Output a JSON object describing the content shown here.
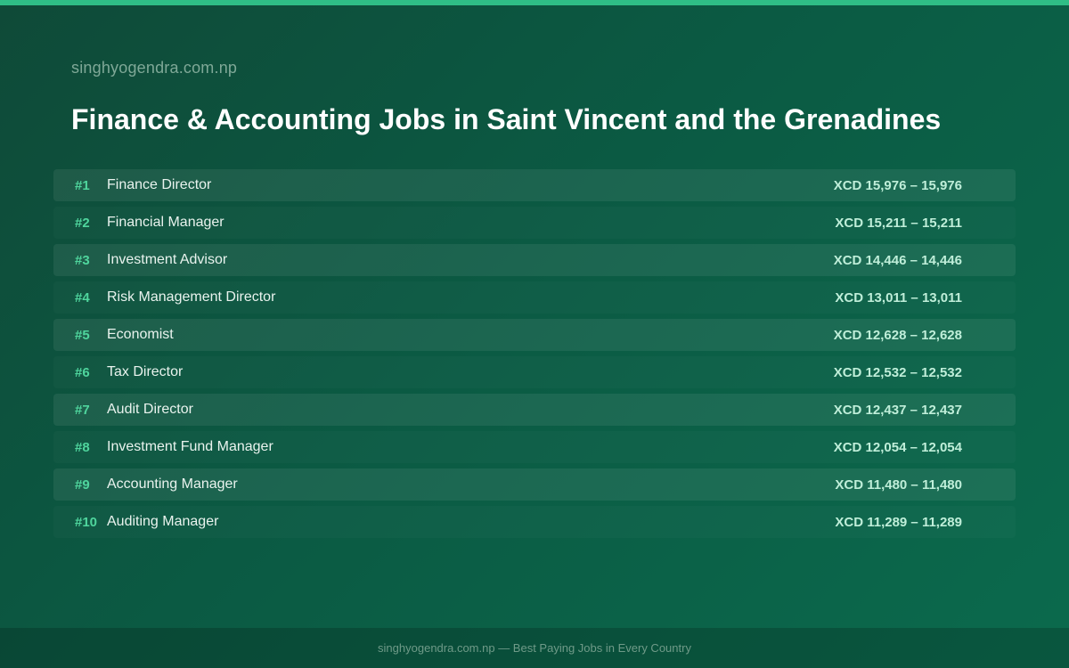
{
  "site": "singhyogendra.com.np",
  "title": "Finance & Accounting Jobs in Saint Vincent and the Grenadines",
  "jobs": [
    {
      "rank": "#1",
      "title": "Finance Director",
      "salary": "XCD 15,976 – 15,976"
    },
    {
      "rank": "#2",
      "title": "Financial Manager",
      "salary": "XCD 15,211 – 15,211"
    },
    {
      "rank": "#3",
      "title": "Investment Advisor",
      "salary": "XCD 14,446 – 14,446"
    },
    {
      "rank": "#4",
      "title": "Risk Management Director",
      "salary": "XCD 13,011 – 13,011"
    },
    {
      "rank": "#5",
      "title": "Economist",
      "salary": "XCD 12,628 – 12,628"
    },
    {
      "rank": "#6",
      "title": "Tax Director",
      "salary": "XCD 12,532 – 12,532"
    },
    {
      "rank": "#7",
      "title": "Audit Director",
      "salary": "XCD 12,437 – 12,437"
    },
    {
      "rank": "#8",
      "title": "Investment Fund Manager",
      "salary": "XCD 12,054 – 12,054"
    },
    {
      "rank": "#9",
      "title": "Accounting Manager",
      "salary": "XCD 11,480 – 11,480"
    },
    {
      "rank": "#10",
      "title": "Auditing Manager",
      "salary": "XCD 11,289 – 11,289"
    }
  ],
  "footer": "singhyogendra.com.np — Best Paying Jobs in Every Country",
  "colors": {
    "accent": "#2fbe86",
    "rank": "#4fd59d",
    "background": "#0b5a43"
  }
}
